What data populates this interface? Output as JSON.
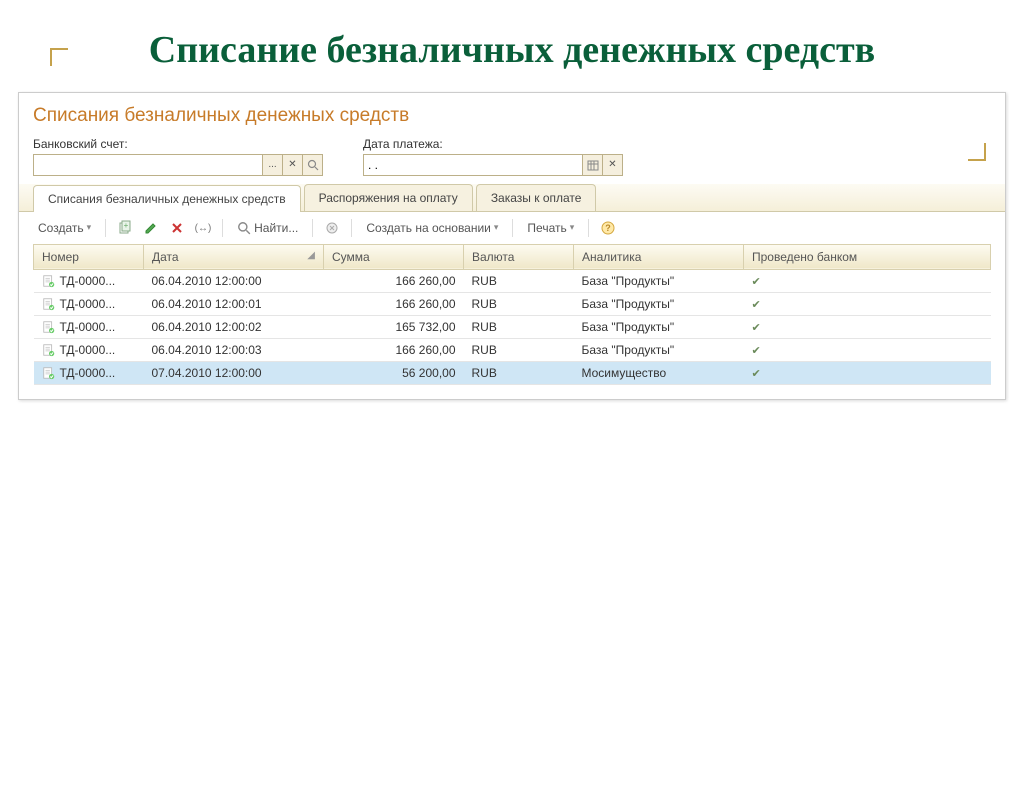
{
  "slide": {
    "title": "Списание безналичных денежных средств"
  },
  "panel": {
    "title": "Списания безналичных денежных средств"
  },
  "filters": {
    "account_label": "Банковский счет:",
    "account_value": "",
    "date_label": "Дата платежа:",
    "date_value": ". ."
  },
  "tabs": [
    {
      "label": "Списания безналичных денежных средств",
      "active": true
    },
    {
      "label": "Распоряжения на оплату",
      "active": false
    },
    {
      "label": "Заказы к оплате",
      "active": false
    }
  ],
  "toolbar": {
    "create": "Создать",
    "find": "Найти...",
    "create_based": "Создать на основании",
    "print": "Печать"
  },
  "table": {
    "headers": {
      "number": "Номер",
      "date": "Дата",
      "sum": "Сумма",
      "currency": "Валюта",
      "analytics": "Аналитика",
      "bank": "Проведено банком"
    },
    "rows": [
      {
        "num": "ТД-0000...",
        "date": "06.04.2010 12:00:00",
        "sum": "166 260,00",
        "cur": "RUB",
        "an": "База \"Продукты\"",
        "bank": true,
        "sel": false
      },
      {
        "num": "ТД-0000...",
        "date": "06.04.2010 12:00:01",
        "sum": "166 260,00",
        "cur": "RUB",
        "an": "База \"Продукты\"",
        "bank": true,
        "sel": false
      },
      {
        "num": "ТД-0000...",
        "date": "06.04.2010 12:00:02",
        "sum": "165 732,00",
        "cur": "RUB",
        "an": "База \"Продукты\"",
        "bank": true,
        "sel": false
      },
      {
        "num": "ТД-0000...",
        "date": "06.04.2010 12:00:03",
        "sum": "166 260,00",
        "cur": "RUB",
        "an": "База \"Продукты\"",
        "bank": true,
        "sel": false
      },
      {
        "num": "ТД-0000...",
        "date": "07.04.2010 12:00:00",
        "sum": "56 200,00",
        "cur": "RUB",
        "an": "Мосимущество",
        "bank": true,
        "sel": true
      }
    ]
  }
}
